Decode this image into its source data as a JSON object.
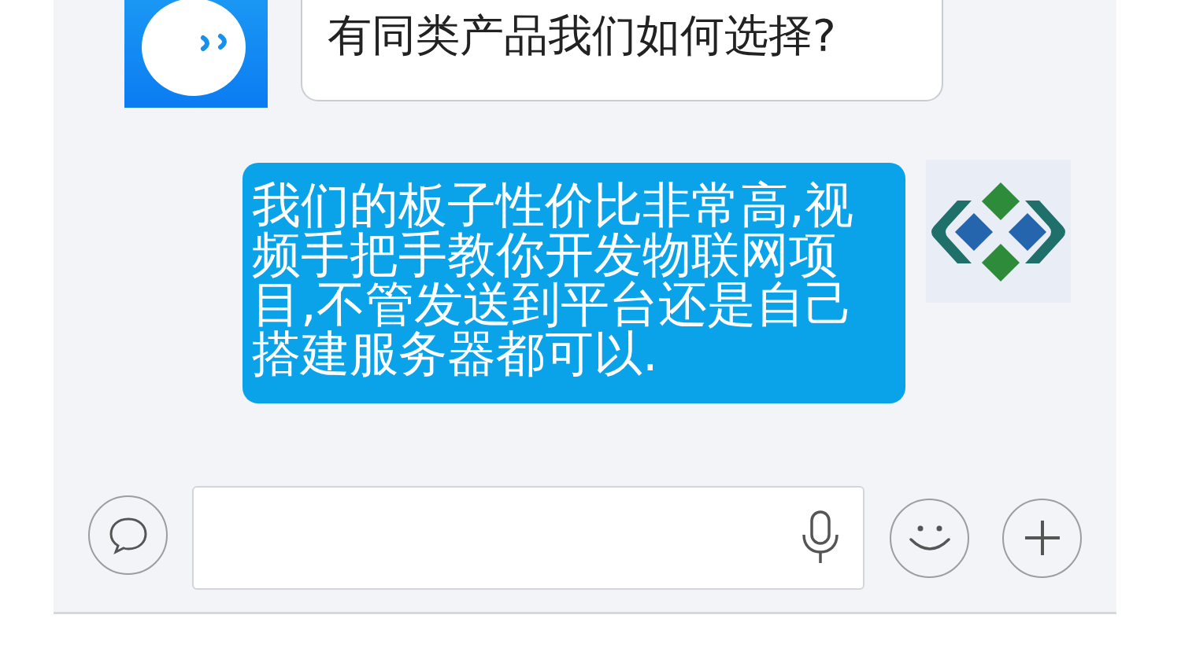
{
  "messages": [
    {
      "kind": "incoming",
      "text": "有同类产品我们如何选择?"
    },
    {
      "kind": "outgoing",
      "text": "我们的板子性价比非常高,视频手把手教你开发物联网项目,不管发送到平台还是自己搭建服务器都可以."
    }
  ]
}
